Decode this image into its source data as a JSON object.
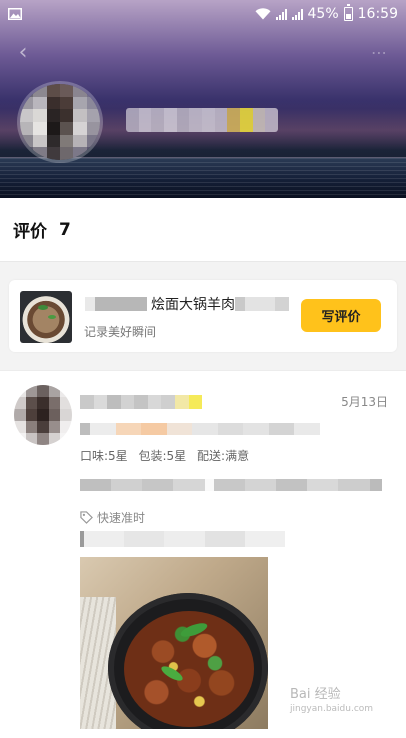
{
  "status_bar": {
    "battery": "45%",
    "time": "16:59"
  },
  "header": {
    "back_icon": "chevron-left-icon",
    "share_icon": "share-icon"
  },
  "rating_section": {
    "label": "评价",
    "count": "7"
  },
  "shop_card": {
    "name": "烩面大锅羊肉",
    "subtitle": "记录美好瞬间",
    "write_button": "写评价"
  },
  "review": {
    "date": "5月13日",
    "scores": {
      "taste": "口味:5星",
      "packaging": "包装:5星",
      "delivery": "配送:满意"
    },
    "tag": "快速准时"
  },
  "watermark": {
    "text": "Bai 经验",
    "site": "jingyan.baidu.com"
  },
  "colors": {
    "accent_button": "#ffc21b",
    "page_gray": "#f3f3f3"
  }
}
